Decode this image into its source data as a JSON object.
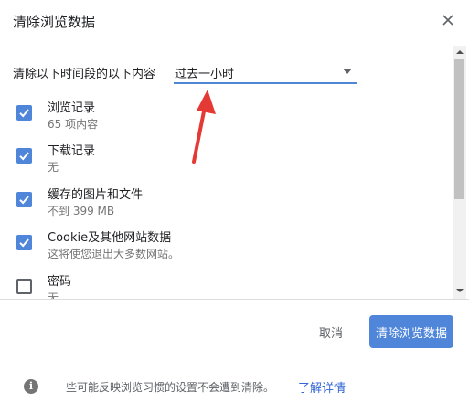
{
  "dialog": {
    "title": "清除浏览数据"
  },
  "time_range": {
    "label": "清除以下时间段的以下内容",
    "selected": "过去一小时"
  },
  "options": [
    {
      "title": "浏览记录",
      "subtitle": "65 项内容",
      "checked": true
    },
    {
      "title": "下载记录",
      "subtitle": "无",
      "checked": true
    },
    {
      "title": "缓存的图片和文件",
      "subtitle": "不到 399 MB",
      "checked": true
    },
    {
      "title": "Cookie及其他网站数据",
      "subtitle": "这将使您退出大多数网站。",
      "checked": true
    },
    {
      "title": "密码",
      "subtitle": "无",
      "checked": false
    }
  ],
  "actions": {
    "cancel_label": "取消",
    "clear_label": "清除浏览数据"
  },
  "footer": {
    "info_text": "一些可能反映浏览习惯的设置不会遭到清除。",
    "link_text": "了解详情"
  },
  "colors": {
    "accent": "#4f86d9",
    "annotation_arrow": "#e53935",
    "link": "#3367d6"
  },
  "icons": {
    "close": "close-icon",
    "dropdown": "caret-down-icon",
    "checkbox": "checkmark-icon",
    "info": "info-icon"
  }
}
